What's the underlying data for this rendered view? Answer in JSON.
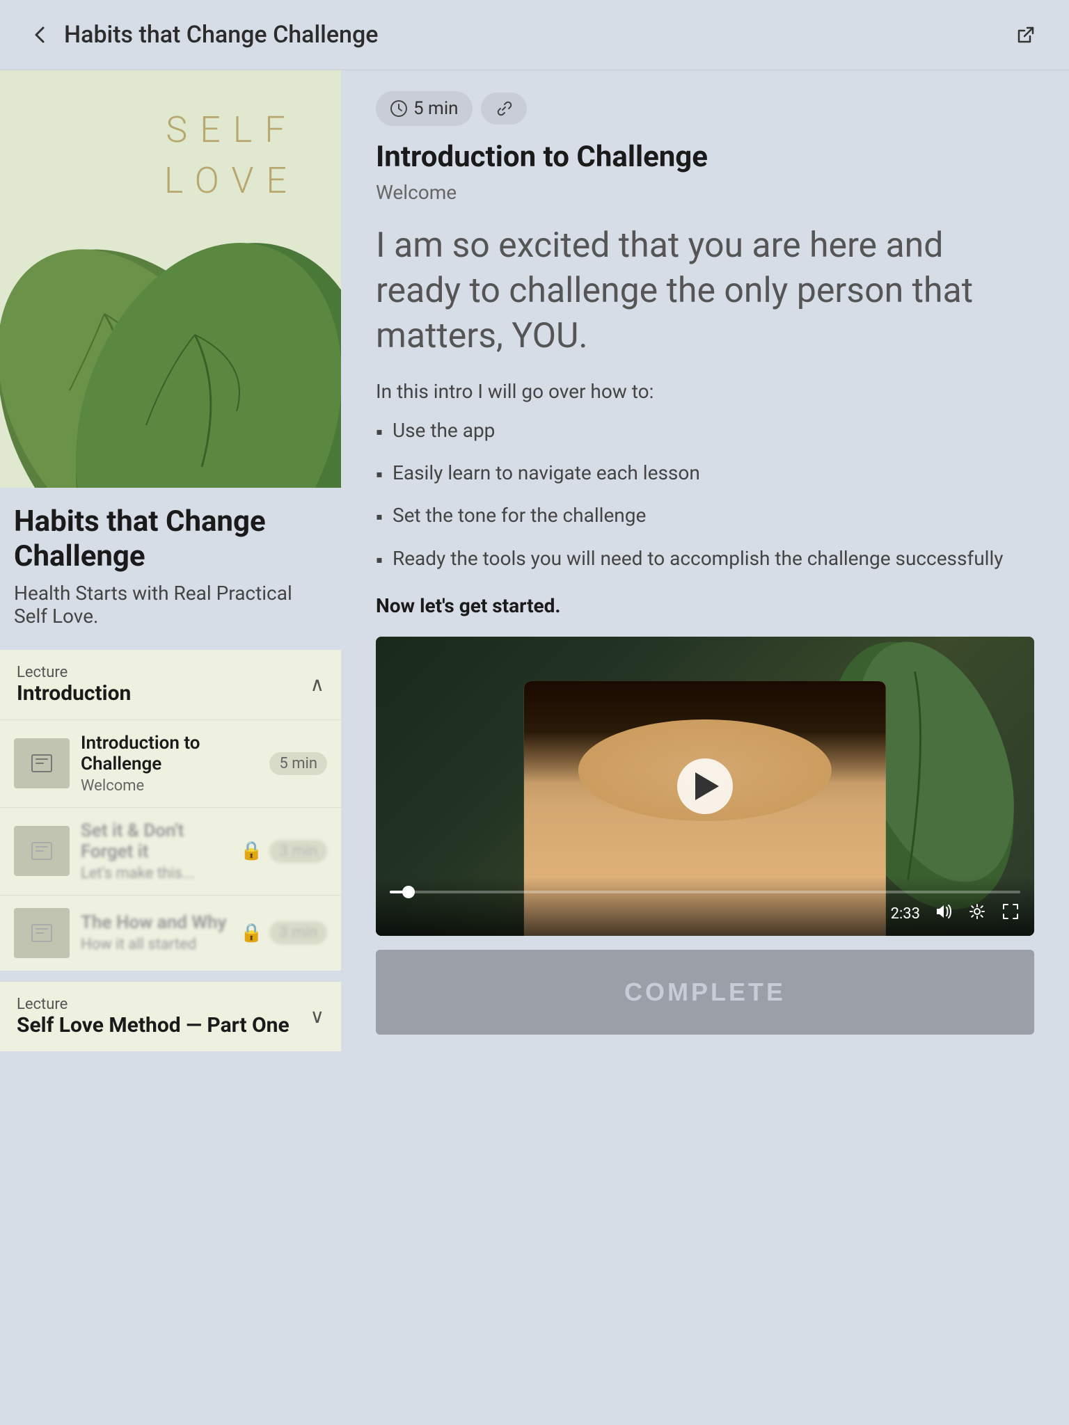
{
  "header": {
    "title": "Habits that Change Challenge",
    "back_label": "back",
    "link_label": "link"
  },
  "left_panel": {
    "course_title": "Habits that Change Challenge",
    "course_subtitle": "Health Starts with Real Practical Self Love.",
    "self_love_lines": [
      "SELF",
      "LOVE"
    ],
    "lecture1": {
      "label": "Lecture",
      "name": "Introduction",
      "expanded": true,
      "lessons": [
        {
          "title": "Introduction to Challenge",
          "subtitle": "Welcome",
          "duration": "5 min",
          "locked": false
        },
        {
          "title": "Set it & Don't Forget it",
          "subtitle": "Let's make this...",
          "duration": "3 min",
          "locked": true
        },
        {
          "title": "The How and Why",
          "subtitle": "How it all started",
          "duration": "3 min",
          "locked": true
        }
      ]
    },
    "lecture2": {
      "label": "Lecture",
      "name": "Self Love Method — Part One",
      "expanded": false
    }
  },
  "right_panel": {
    "duration": "5 min",
    "content_title": "Introduction to Challenge",
    "content_subtitle": "Welcome",
    "big_quote": "I am so excited that you are here and ready to challenge the only person that matters, YOU.",
    "intro_text": "In this intro I will go over how to:",
    "bullets": [
      "Use the app",
      "Easily learn to navigate each lesson",
      "Set the tone for the challenge",
      "Ready the tools you will need to accomplish the challenge successfully"
    ],
    "call_to_action": "Now let's get started.",
    "video": {
      "time_remaining": "2:33",
      "progress_percent": 3
    },
    "complete_button": "COMPLETE"
  }
}
